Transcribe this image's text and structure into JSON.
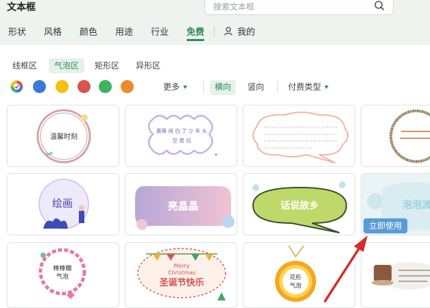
{
  "header": {
    "title": "文本框",
    "search_placeholder": "搜索文本框"
  },
  "nav": {
    "tabs": [
      "形状",
      "风格",
      "颜色",
      "用途",
      "行业",
      "免费"
    ],
    "active_tab": "免费",
    "mine_label": "我的"
  },
  "subtabs": {
    "items": [
      "线框区",
      "气泡区",
      "矩形区",
      "异形区"
    ],
    "active": "气泡区"
  },
  "filters": {
    "colors": [
      "#e74c3c",
      "#3b78d8",
      "#f4c20d",
      "#d9534f",
      "#3cb35f",
      "#ee8a2e"
    ],
    "more_label": "更多",
    "horizontal_label": "横向",
    "vertical_label": "竖向",
    "pay_type_label": "付费类型"
  },
  "cards": {
    "c1": "温馨时刻",
    "c2a": "莫等 闲 白 了 少 年 头",
    "c2b": "空 悲 切",
    "c5": "绘画",
    "c6": "亮晶晶",
    "c7": "话说故乡",
    "c8": "泡泡流",
    "c9a": "棒棒糖",
    "c9b": "气泡",
    "c10a": "Merry",
    "c10b": "Christmas",
    "c10c": "圣诞节快乐",
    "c11a": "花形",
    "c11b": "气泡"
  },
  "use_button": "立即使用"
}
